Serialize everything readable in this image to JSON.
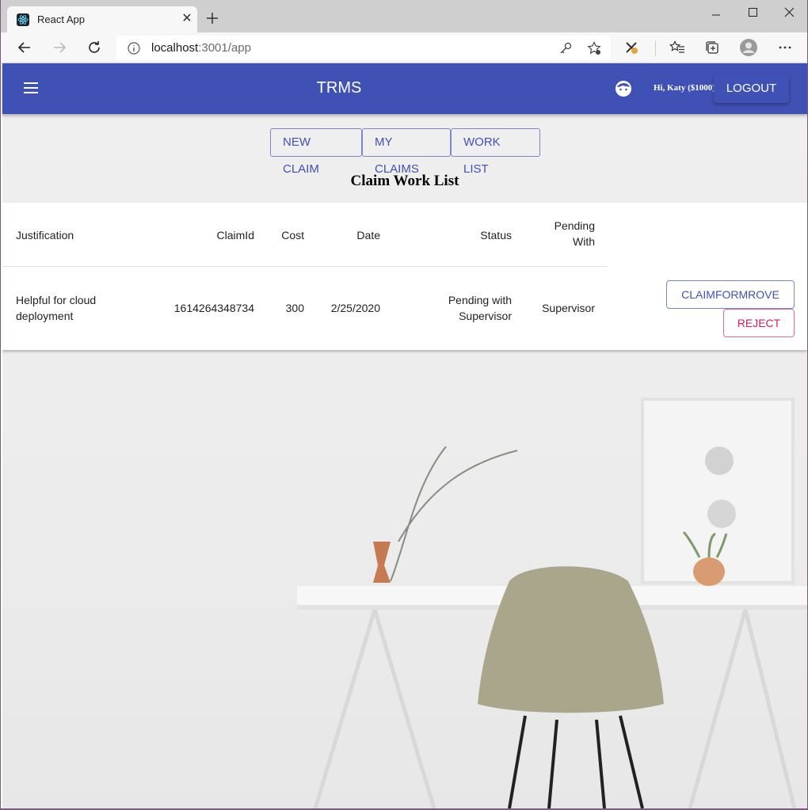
{
  "browser": {
    "tab_title": "React App",
    "tab_close": "✕",
    "url_host": "localhost",
    "url_rest": ":3001/app"
  },
  "header": {
    "title": "TRMS",
    "greeting": "Hi, Katy ($1000)",
    "logout_label": "LOGOUT",
    "accent": "#3f51b5"
  },
  "nav_buttons": {
    "new_claim": "NEW CLAIM",
    "my_claims": "MY CLAIMS",
    "work_list": "WORK LIST"
  },
  "page_title": "Claim Work List",
  "table": {
    "headers": {
      "justification": "Justification",
      "claim_id": "ClaimId",
      "cost": "Cost",
      "date": "Date",
      "status": "Status",
      "pending_with_1": "Pending",
      "pending_with_2": "With"
    },
    "rows": [
      {
        "justification_1": "Helpful for cloud",
        "justification_2": "deployment",
        "claim_id": "1614264348734",
        "cost": "300",
        "date": "2/25/2020",
        "status_1": "Pending with",
        "status_2": "Supervisor",
        "pending_with": "Supervisor",
        "approve_label": "CLAIMFORMROVE",
        "reject_label": "REJECT"
      }
    ]
  }
}
